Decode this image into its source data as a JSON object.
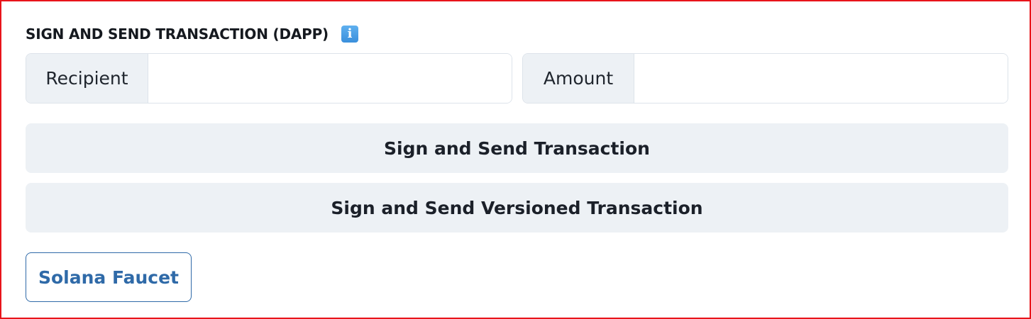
{
  "section": {
    "title": "SIGN AND SEND TRANSACTION (DAPP)",
    "info_icon": "info-icon",
    "info_glyph": "i"
  },
  "recipient": {
    "label": "Recipient",
    "value": ""
  },
  "amount": {
    "label": "Amount",
    "value": ""
  },
  "buttons": {
    "sign_send": "Sign and Send Transaction",
    "sign_send_versioned": "Sign and Send Versioned Transaction",
    "faucet": "Solana Faucet"
  },
  "colors": {
    "border_highlight": "#e8141a",
    "button_bg": "#edf1f5",
    "link_blue": "#2f6aa8",
    "info_blue": "#3a8fdc"
  }
}
